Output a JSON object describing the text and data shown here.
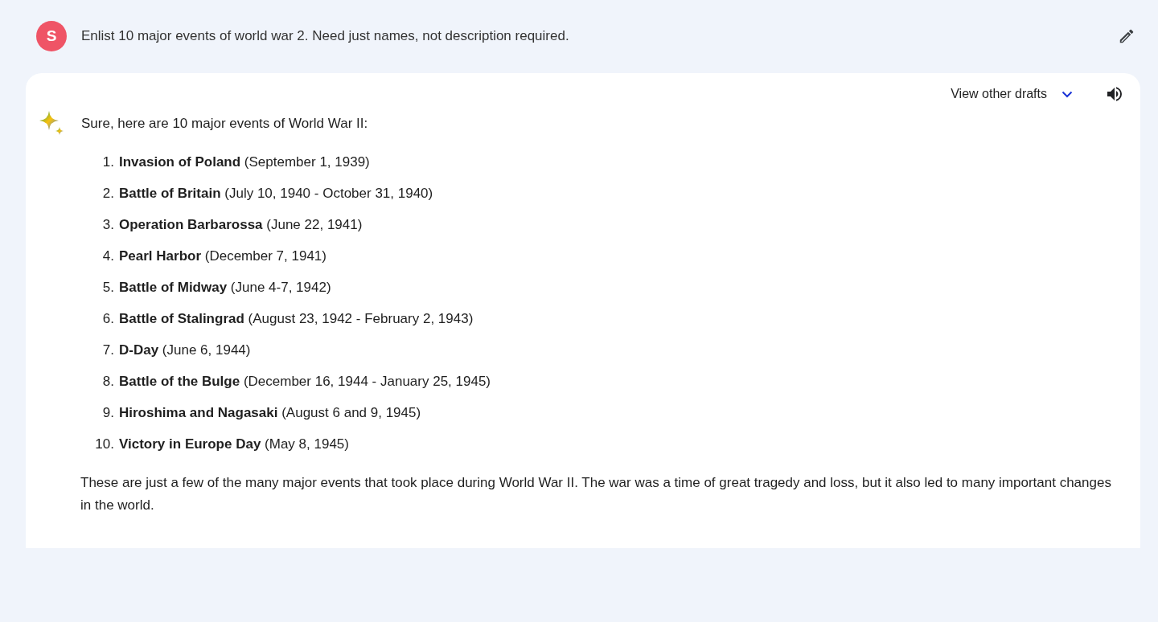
{
  "prompt": {
    "avatar_letter": "S",
    "text": "Enlist 10 major events of world war 2. Need just names, not description required."
  },
  "response": {
    "drafts_label": "View other drafts",
    "intro": "Sure, here are 10 major events of World War II:",
    "events": [
      {
        "number": "1.",
        "text": "**Invasion of Poland** (September 1, 1939)"
      },
      {
        "number": "2.",
        "text": "**Battle of Britain** (July 10, 1940 - October 31, 1940)"
      },
      {
        "number": "3.",
        "text": "**Operation Barbarossa** (June 22, 1941)"
      },
      {
        "number": "4.",
        "text": "**Pearl Harbor** (December 7, 1941)"
      },
      {
        "number": "5.",
        "text": "**Battle of Midway** (June 4-7, 1942)"
      },
      {
        "number": "6.",
        "text": "**Battle of Stalingrad** (August 23, 1942 - February 2, 1943)"
      },
      {
        "number": "7.",
        "text": "**D-Day** (June 6, 1944)"
      },
      {
        "number": "8.",
        "text": "**Battle of the Bulge** (December 16, 1944 - January 25, 1945)"
      },
      {
        "number": "9.",
        "text": "**Hiroshima and Nagasaki** (August 6 and 9, 1945)"
      },
      {
        "number": "10.",
        "text": "**Victory in Europe Day** (May 8, 1945)"
      }
    ],
    "closing": "These are just a few of the many major events that took place during World War II. The war was a time of great tragedy and loss, but it also led to many important changes in the world."
  }
}
